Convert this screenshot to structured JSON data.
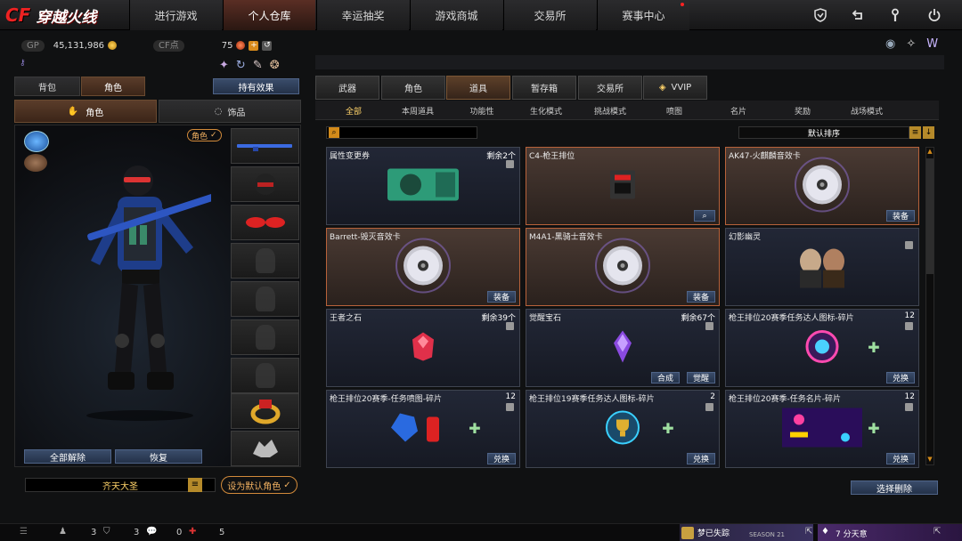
{
  "app": {
    "logo_cf": "CF",
    "logo_title": "穿越火线"
  },
  "nav": [
    {
      "label": "进行游戏"
    },
    {
      "label": "个人仓库",
      "active": true
    },
    {
      "label": "幸运抽奖"
    },
    {
      "label": "游戏商城"
    },
    {
      "label": "交易所"
    },
    {
      "label": "赛事中心",
      "dot": true
    }
  ],
  "sys_icons": [
    "shield-icon",
    "return-icon",
    "wrench-icon",
    "power-icon"
  ],
  "wallet": {
    "gp_label": "GP",
    "gp_value": "45,131,986",
    "cf_label": "CF点",
    "cf_value": "75"
  },
  "left": {
    "tabs": [
      "背包",
      "角色"
    ],
    "holding_effect": "持有效果",
    "subtabs": [
      "角色",
      "饰品"
    ],
    "role_badge": "角色",
    "unequip_all": "全部解除",
    "restore": "恢复",
    "character_name": "齐天大圣",
    "set_default": "设为默认角色"
  },
  "right": {
    "tabs": [
      "武器",
      "角色",
      "道具",
      "暂存箱",
      "交易所",
      "VVIP"
    ],
    "active_tab": 2,
    "subtabs": [
      "全部",
      "本周道具",
      "功能性",
      "生化模式",
      "挑战模式",
      "喷图",
      "名片",
      "奖励",
      "战场模式"
    ],
    "active_subtab": 0,
    "sort_label": "默认排序",
    "select_delete": "选择删除",
    "items": [
      {
        "title": "属性变更券",
        "count": "剩余2个",
        "lock": true,
        "warm": false,
        "actions": [],
        "art": "ticket"
      },
      {
        "title": "C4-枪王排位",
        "count": "",
        "lock": false,
        "warm": true,
        "actions": [
          "search"
        ],
        "art": "c4"
      },
      {
        "title": "AK47-火麒麟音效卡",
        "count": "",
        "lock": false,
        "warm": true,
        "actions": [
          "装备"
        ],
        "art": "disc"
      },
      {
        "title": "Barrett-毁灭音效卡",
        "count": "",
        "lock": false,
        "warm": true,
        "actions": [
          "装备"
        ],
        "art": "disc"
      },
      {
        "title": "M4A1-黑骑士音效卡",
        "count": "",
        "lock": false,
        "warm": true,
        "actions": [
          "装备"
        ],
        "art": "disc"
      },
      {
        "title": "幻影幽灵",
        "count": "",
        "lock": true,
        "warm": false,
        "actions": [],
        "art": "ghost"
      },
      {
        "title": "王者之石",
        "count": "剩余39个",
        "lock": true,
        "warm": false,
        "actions": [],
        "art": "redgem"
      },
      {
        "title": "觉醒宝石",
        "count": "剩余67个",
        "lock": true,
        "warm": false,
        "actions": [
          "合成",
          "觉醒"
        ],
        "art": "purplegem"
      },
      {
        "title": "枪王排位20赛季任务达人图标-碎片",
        "count": "12",
        "lock": true,
        "warm": false,
        "actions": [
          "兑换"
        ],
        "art": "badge"
      },
      {
        "title": "枪王排位20赛季-任务喷图-碎片",
        "count": "12",
        "lock": true,
        "warm": false,
        "actions": [
          "兑换"
        ],
        "art": "spray"
      },
      {
        "title": "枪王排位19赛季任务达人图标-碎片",
        "count": "2",
        "lock": true,
        "warm": false,
        "actions": [
          "兑换"
        ],
        "art": "trophy"
      },
      {
        "title": "枪王排位20赛季-任务名片-碎片",
        "count": "12",
        "lock": true,
        "warm": false,
        "actions": [
          "兑换"
        ],
        "art": "rankcard"
      }
    ]
  },
  "bottom": {
    "c1": "3",
    "c2": "3",
    "c3": "0",
    "c4": "5",
    "season_text": "梦已失踪",
    "season_label": "SEASON 21",
    "friend_text": "7 分天意"
  },
  "colors": {
    "accent": "#b8623a",
    "nav_active": "#5a2e24",
    "gold": "#ffd36a"
  }
}
